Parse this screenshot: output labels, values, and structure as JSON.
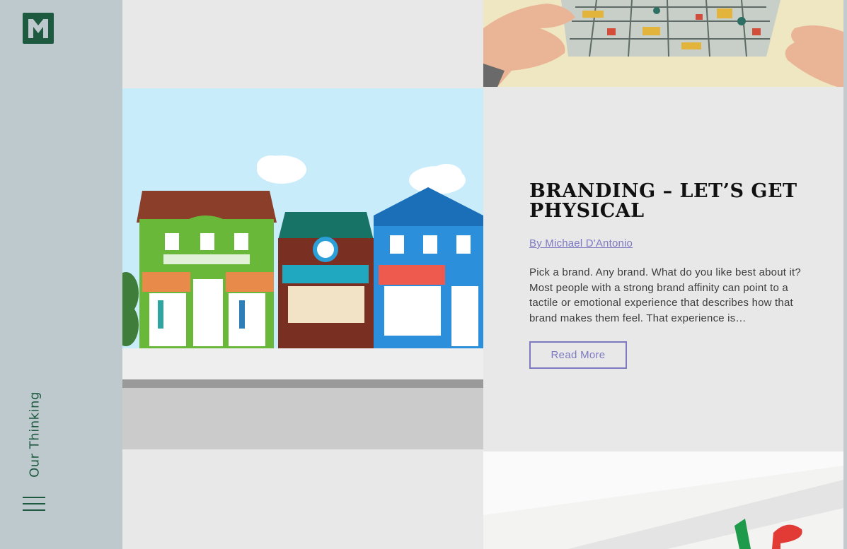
{
  "sidebar": {
    "section_label": "Our Thinking",
    "logo_icon": "m-monogram-logo",
    "menu_icon": "hamburger-menu-icon"
  },
  "post": {
    "title": "BRANDING – LET’S GET PHYSICAL",
    "author": "By Michael D'Antonio",
    "excerpt": "Pick a brand. Any brand. What do you like best about it? Most people with a strong brand affinity can point to a tactile or emotional experience that describes how that brand makes them feel. That experience is…",
    "read_more_label": "Read More"
  },
  "colors": {
    "sidebar_bg": "#bec9cd",
    "brand_green": "#1e5a40",
    "accent_purple": "#7d79c0",
    "tile_bg": "#e8e8e9"
  }
}
